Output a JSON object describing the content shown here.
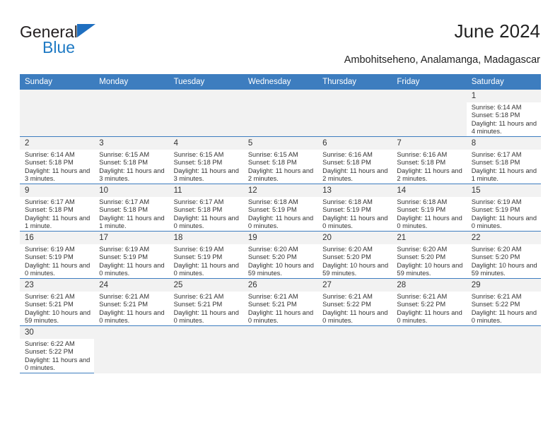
{
  "brand": {
    "name_top": "General",
    "name_bottom": "Blue",
    "triangle_color": "#1f6fc0",
    "blue_color": "#1f7ac4"
  },
  "header": {
    "title": "June 2024",
    "subtitle": "Ambohitseheno, Analamanga, Madagascar"
  },
  "theme": {
    "header_bg": "#3d7dbf",
    "daynum_bg": "#f2f2f2",
    "empty_bg": "#f2f2f2",
    "grid_line": "#3d7dbf",
    "text": "#333333"
  },
  "calendar": {
    "weekday_headers": [
      "Sunday",
      "Monday",
      "Tuesday",
      "Wednesday",
      "Thursday",
      "Friday",
      "Saturday"
    ],
    "labels": {
      "sunrise": "Sunrise:",
      "sunset": "Sunset:",
      "daylight": "Daylight:"
    },
    "weeks": [
      [
        {
          "day": "",
          "empty": true
        },
        {
          "day": "",
          "empty": true
        },
        {
          "day": "",
          "empty": true
        },
        {
          "day": "",
          "empty": true
        },
        {
          "day": "",
          "empty": true
        },
        {
          "day": "",
          "empty": true
        },
        {
          "day": "1",
          "sunrise": "Sunrise: 6:14 AM",
          "sunset": "Sunset: 5:18 PM",
          "daylight": "Daylight: 11 hours and 4 minutes."
        }
      ],
      [
        {
          "day": "2",
          "sunrise": "Sunrise: 6:14 AM",
          "sunset": "Sunset: 5:18 PM",
          "daylight": "Daylight: 11 hours and 3 minutes."
        },
        {
          "day": "3",
          "sunrise": "Sunrise: 6:15 AM",
          "sunset": "Sunset: 5:18 PM",
          "daylight": "Daylight: 11 hours and 3 minutes."
        },
        {
          "day": "4",
          "sunrise": "Sunrise: 6:15 AM",
          "sunset": "Sunset: 5:18 PM",
          "daylight": "Daylight: 11 hours and 3 minutes."
        },
        {
          "day": "5",
          "sunrise": "Sunrise: 6:15 AM",
          "sunset": "Sunset: 5:18 PM",
          "daylight": "Daylight: 11 hours and 2 minutes."
        },
        {
          "day": "6",
          "sunrise": "Sunrise: 6:16 AM",
          "sunset": "Sunset: 5:18 PM",
          "daylight": "Daylight: 11 hours and 2 minutes."
        },
        {
          "day": "7",
          "sunrise": "Sunrise: 6:16 AM",
          "sunset": "Sunset: 5:18 PM",
          "daylight": "Daylight: 11 hours and 2 minutes."
        },
        {
          "day": "8",
          "sunrise": "Sunrise: 6:17 AM",
          "sunset": "Sunset: 5:18 PM",
          "daylight": "Daylight: 11 hours and 1 minute."
        }
      ],
      [
        {
          "day": "9",
          "sunrise": "Sunrise: 6:17 AM",
          "sunset": "Sunset: 5:18 PM",
          "daylight": "Daylight: 11 hours and 1 minute."
        },
        {
          "day": "10",
          "sunrise": "Sunrise: 6:17 AM",
          "sunset": "Sunset: 5:18 PM",
          "daylight": "Daylight: 11 hours and 1 minute."
        },
        {
          "day": "11",
          "sunrise": "Sunrise: 6:17 AM",
          "sunset": "Sunset: 5:18 PM",
          "daylight": "Daylight: 11 hours and 0 minutes."
        },
        {
          "day": "12",
          "sunrise": "Sunrise: 6:18 AM",
          "sunset": "Sunset: 5:19 PM",
          "daylight": "Daylight: 11 hours and 0 minutes."
        },
        {
          "day": "13",
          "sunrise": "Sunrise: 6:18 AM",
          "sunset": "Sunset: 5:19 PM",
          "daylight": "Daylight: 11 hours and 0 minutes."
        },
        {
          "day": "14",
          "sunrise": "Sunrise: 6:18 AM",
          "sunset": "Sunset: 5:19 PM",
          "daylight": "Daylight: 11 hours and 0 minutes."
        },
        {
          "day": "15",
          "sunrise": "Sunrise: 6:19 AM",
          "sunset": "Sunset: 5:19 PM",
          "daylight": "Daylight: 11 hours and 0 minutes."
        }
      ],
      [
        {
          "day": "16",
          "sunrise": "Sunrise: 6:19 AM",
          "sunset": "Sunset: 5:19 PM",
          "daylight": "Daylight: 11 hours and 0 minutes."
        },
        {
          "day": "17",
          "sunrise": "Sunrise: 6:19 AM",
          "sunset": "Sunset: 5:19 PM",
          "daylight": "Daylight: 11 hours and 0 minutes."
        },
        {
          "day": "18",
          "sunrise": "Sunrise: 6:19 AM",
          "sunset": "Sunset: 5:19 PM",
          "daylight": "Daylight: 11 hours and 0 minutes."
        },
        {
          "day": "19",
          "sunrise": "Sunrise: 6:20 AM",
          "sunset": "Sunset: 5:20 PM",
          "daylight": "Daylight: 10 hours and 59 minutes."
        },
        {
          "day": "20",
          "sunrise": "Sunrise: 6:20 AM",
          "sunset": "Sunset: 5:20 PM",
          "daylight": "Daylight: 10 hours and 59 minutes."
        },
        {
          "day": "21",
          "sunrise": "Sunrise: 6:20 AM",
          "sunset": "Sunset: 5:20 PM",
          "daylight": "Daylight: 10 hours and 59 minutes."
        },
        {
          "day": "22",
          "sunrise": "Sunrise: 6:20 AM",
          "sunset": "Sunset: 5:20 PM",
          "daylight": "Daylight: 10 hours and 59 minutes."
        }
      ],
      [
        {
          "day": "23",
          "sunrise": "Sunrise: 6:21 AM",
          "sunset": "Sunset: 5:21 PM",
          "daylight": "Daylight: 10 hours and 59 minutes."
        },
        {
          "day": "24",
          "sunrise": "Sunrise: 6:21 AM",
          "sunset": "Sunset: 5:21 PM",
          "daylight": "Daylight: 11 hours and 0 minutes."
        },
        {
          "day": "25",
          "sunrise": "Sunrise: 6:21 AM",
          "sunset": "Sunset: 5:21 PM",
          "daylight": "Daylight: 11 hours and 0 minutes."
        },
        {
          "day": "26",
          "sunrise": "Sunrise: 6:21 AM",
          "sunset": "Sunset: 5:21 PM",
          "daylight": "Daylight: 11 hours and 0 minutes."
        },
        {
          "day": "27",
          "sunrise": "Sunrise: 6:21 AM",
          "sunset": "Sunset: 5:22 PM",
          "daylight": "Daylight: 11 hours and 0 minutes."
        },
        {
          "day": "28",
          "sunrise": "Sunrise: 6:21 AM",
          "sunset": "Sunset: 5:22 PM",
          "daylight": "Daylight: 11 hours and 0 minutes."
        },
        {
          "day": "29",
          "sunrise": "Sunrise: 6:21 AM",
          "sunset": "Sunset: 5:22 PM",
          "daylight": "Daylight: 11 hours and 0 minutes."
        }
      ],
      [
        {
          "day": "30",
          "sunrise": "Sunrise: 6:22 AM",
          "sunset": "Sunset: 5:22 PM",
          "daylight": "Daylight: 11 hours and 0 minutes."
        },
        {
          "day": "",
          "empty": true
        },
        {
          "day": "",
          "empty": true
        },
        {
          "day": "",
          "empty": true
        },
        {
          "day": "",
          "empty": true
        },
        {
          "day": "",
          "empty": true
        },
        {
          "day": "",
          "empty": true
        }
      ]
    ]
  }
}
